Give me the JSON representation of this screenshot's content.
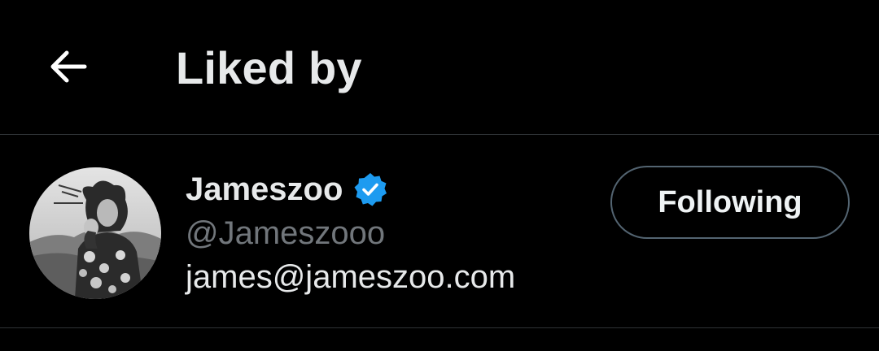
{
  "header": {
    "back_icon": "arrow-left-icon",
    "title": "Liked by"
  },
  "user": {
    "display_name": "Jameszoo",
    "verified_icon": "verified-badge-icon",
    "handle": "@Jameszooo",
    "bio": "james@jameszoo.com",
    "follow_button_label": "Following"
  },
  "colors": {
    "background": "#000000",
    "primary_text": "#e7e9ea",
    "secondary_text": "#71767b",
    "verified_blue": "#1d9bf0",
    "divider": "#2f3336",
    "button_border": "#536471"
  }
}
